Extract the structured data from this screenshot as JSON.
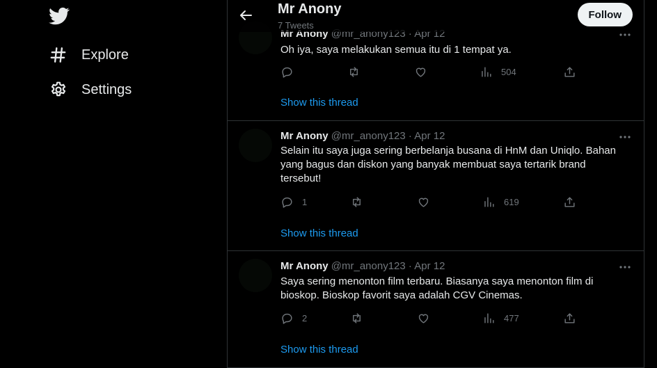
{
  "nav": {
    "logo": "twitter-bird-icon",
    "items": [
      {
        "label": "Explore",
        "icon": "hashtag-icon"
      },
      {
        "label": "Settings",
        "icon": "gear-icon"
      }
    ]
  },
  "header": {
    "name": "Mr Anony",
    "tweet_count": "7 Tweets",
    "follow_label": "Follow",
    "back_icon": "arrow-left-icon"
  },
  "tweets": [
    {
      "name": "Mr Anony",
      "handle": "@mr_anony123",
      "date": "· Apr 12",
      "text": "Oh iya, saya melakukan semua itu di 1 tempat ya.",
      "replies": "",
      "retweets": "",
      "likes": "",
      "views": "504",
      "thread_link": "Show this thread"
    },
    {
      "name": "Mr Anony",
      "handle": "@mr_anony123",
      "date": "· Apr 12",
      "text": "Selain itu saya juga sering berbelanja busana di HnM dan Uniqlo. Bahan yang bagus dan diskon yang banyak membuat saya tertarik brand tersebut!",
      "replies": "1",
      "retweets": "",
      "likes": "",
      "views": "619",
      "thread_link": "Show this thread"
    },
    {
      "name": "Mr Anony",
      "handle": "@mr_anony123",
      "date": "· Apr 12",
      "text": "Saya sering menonton film terbaru. Biasanya saya menonton film di bioskop. Bioskop favorit saya adalah CGV Cinemas.",
      "replies": "2",
      "retweets": "",
      "likes": "",
      "views": "477",
      "thread_link": "Show this thread"
    }
  ],
  "colors": {
    "background": "#000000",
    "text": "#e7e9ea",
    "secondary": "#71767b",
    "link": "#1d9bf0",
    "border": "#2f3336",
    "follow_bg": "#eff3f4"
  }
}
